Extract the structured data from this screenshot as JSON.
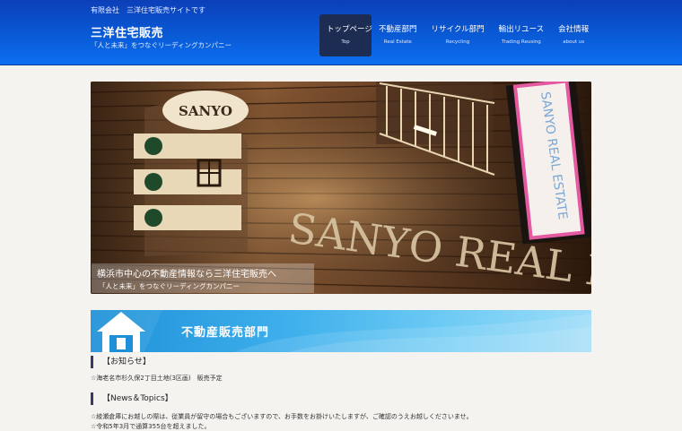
{
  "header": {
    "tagline": "有限会社　三洋住宅販売サイトです",
    "site_title": "三洋住宅販売",
    "site_subtitle": "「人と未来」をつなぐリーディングカンパニー"
  },
  "nav": [
    {
      "label": "トップページ",
      "sub": "Top",
      "active": true
    },
    {
      "label": "不動産部門",
      "sub": "Real Estate",
      "active": false
    },
    {
      "label": "リサイクル部門",
      "sub": "Recycling",
      "active": false
    },
    {
      "label": "輸出リユース",
      "sub": "Trading Reusing",
      "active": false
    },
    {
      "label": "会社情報",
      "sub": "about us",
      "active": false
    }
  ],
  "hero": {
    "caption_title": "横浜市中心の不動産情報なら三洋住宅販売へ",
    "caption_sub": "「人と未来」をつなぐリーディングカンパニー",
    "sign_left": "SANYO",
    "sign_main": "SANYO REAL ESTATE",
    "sign_vertical": "SANYO REAL ESTATE"
  },
  "section": {
    "title": "不動産販売部門"
  },
  "notices": {
    "heading": "【お知らせ】",
    "item1": "☆海老名市杉久保2丁目土地(3区画)　販売予定"
  },
  "news": {
    "heading": "【News＆Topics】",
    "item1": "☆綾瀬倉庫にお越しの際は、従業員が留守の場合もございますので、お手数をお掛けいたしますが、ご確認のうえお越しくださいませ。",
    "item2": "☆令和5年3月で通算355台を超えました。"
  },
  "colors": {
    "header_blue": "#0a5ad6",
    "nav_active": "#1c2c52",
    "banner_blue": "#3fb0ec"
  }
}
